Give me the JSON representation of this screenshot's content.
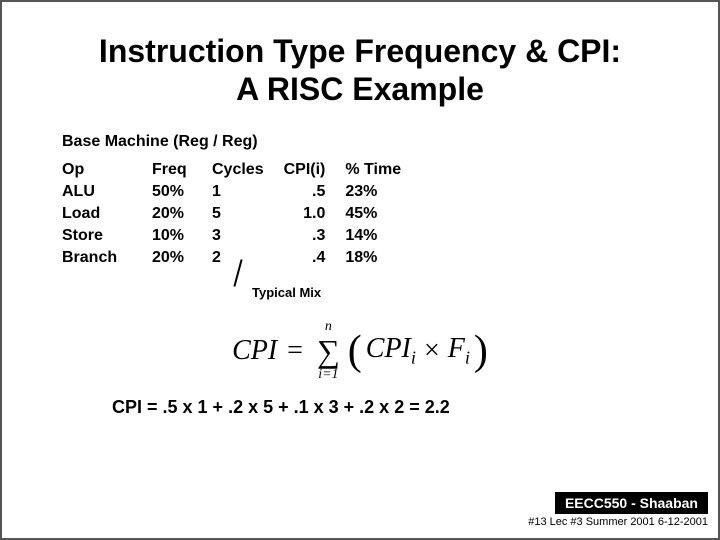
{
  "title": {
    "line1": "Instruction Type Frequency & CPI:",
    "line2": "A RISC Example"
  },
  "table": {
    "subtitle": "Base Machine (Reg / Reg)",
    "headers": [
      "Op",
      "Freq",
      "Cycles",
      "CPI(i)",
      "% Time"
    ],
    "rows": [
      [
        "ALU",
        "50%",
        "1",
        ".5",
        "23%"
      ],
      [
        "Load",
        "20%",
        "5",
        "1.0",
        "45%"
      ],
      [
        "Store",
        "10%",
        "3",
        ".3",
        "14%"
      ],
      [
        "Branch",
        "20%",
        "2",
        ".4",
        "18%"
      ]
    ]
  },
  "typical_mix_label": "Typical Mix",
  "formula_display": "CPI = Σ (CPIᵢ × Fᵢ)",
  "cpi_equation": "CPI  =  .5 x 1 +  .2 x 5 +  .1 x 3 +  .2 x 2  = 2.2",
  "footer": {
    "badge": "EECC550 - Shaaban",
    "info": "#13   Lec #3   Summer 2001   6-12-2001"
  }
}
